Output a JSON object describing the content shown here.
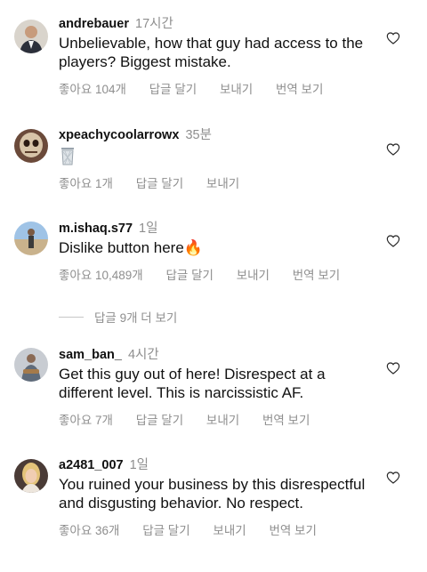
{
  "comments": [
    {
      "username": "andrebauer",
      "time": "17시간",
      "text": "Unbelievable, how that guy had access to the players? Biggest mistake.",
      "likes": "좋아요 104개",
      "reply": "답글 달기",
      "send": "보내기",
      "translate": "번역 보기"
    },
    {
      "username": "xpeachycoolarrowx",
      "time": "35분",
      "text": "🗑",
      "likes": "좋아요 1개",
      "reply": "답글 달기",
      "send": "보내기"
    },
    {
      "username": "m.ishaq.s77",
      "time": "1일",
      "text": "Dislike button here🔥",
      "likes": "좋아요 10,489개",
      "reply": "답글 달기",
      "send": "보내기",
      "translate": "번역 보기"
    },
    {
      "username": "sam_ban_",
      "time": "4시간",
      "text": "Get this guy out of here! Disrespect at a different level. This is narcissistic AF.",
      "likes": "좋아요 7개",
      "reply": "답글 달기",
      "send": "보내기",
      "translate": "번역 보기"
    },
    {
      "username": "a2481_007",
      "time": "1일",
      "text": "You ruined your business by this disrespectful and disgusting behavior. No respect.",
      "likes": "좋아요 36개",
      "reply": "답글 달기",
      "send": "보내기",
      "translate": "번역 보기"
    }
  ],
  "view_replies": "답글 9개 더 보기"
}
